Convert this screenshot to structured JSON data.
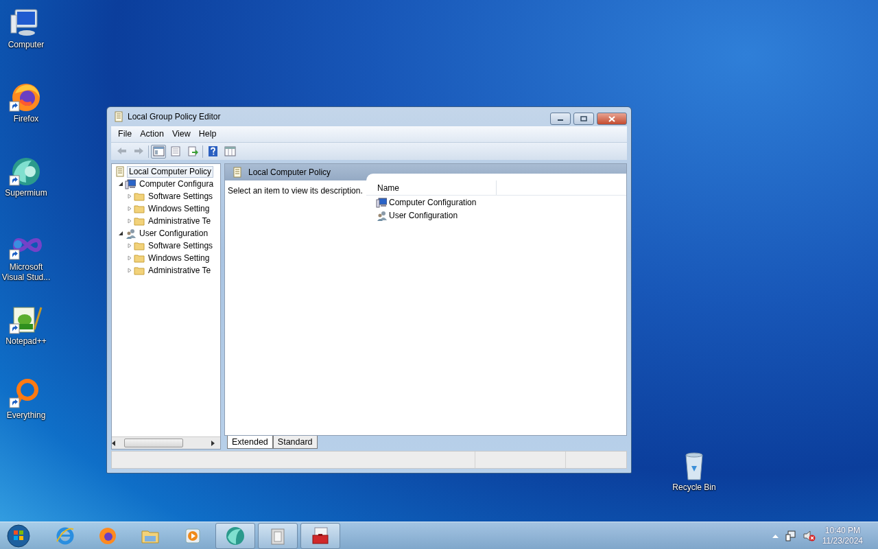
{
  "desktop_icons": [
    {
      "label": "Computer",
      "kind": "computer",
      "shortcut": false
    },
    {
      "label": "Firefox",
      "kind": "firefox",
      "shortcut": true
    },
    {
      "label": "Supermium",
      "kind": "supermium",
      "shortcut": true
    },
    {
      "label": "Microsoft Visual Stud...",
      "kind": "vs",
      "shortcut": true
    },
    {
      "label": "Notepad++",
      "kind": "notepad",
      "shortcut": true
    },
    {
      "label": "Everything",
      "kind": "everything",
      "shortcut": true
    }
  ],
  "recycle_bin": {
    "label": "Recycle Bin"
  },
  "window": {
    "title": "Local Group Policy Editor",
    "menu": [
      "File",
      "Action",
      "View",
      "Help"
    ],
    "toolbar": [
      {
        "kind": "back",
        "disabled": true,
        "pressed": false
      },
      {
        "kind": "forward",
        "disabled": true,
        "pressed": false
      },
      {
        "kind": "tree",
        "disabled": false,
        "pressed": true
      },
      {
        "kind": "properties",
        "disabled": false,
        "pressed": false
      },
      {
        "kind": "export",
        "disabled": false,
        "pressed": false
      },
      {
        "kind": "help",
        "disabled": false,
        "pressed": false
      },
      {
        "kind": "view",
        "disabled": false,
        "pressed": false
      }
    ],
    "tree": {
      "label": "Local Computer Policy",
      "kind": "policy",
      "selected": true,
      "children": [
        {
          "label": "Computer Configura",
          "kind": "computer",
          "expanded": true,
          "selected": false,
          "children": [
            {
              "label": "Software Settings",
              "kind": "folder",
              "expanded": false,
              "selected": false
            },
            {
              "label": "Windows Setting",
              "kind": "folder",
              "expanded": false,
              "selected": false
            },
            {
              "label": "Administrative Te",
              "kind": "folder",
              "expanded": false,
              "selected": false
            }
          ]
        },
        {
          "label": "User Configuration",
          "kind": "user",
          "expanded": true,
          "selected": false,
          "children": [
            {
              "label": "Software Settings",
              "kind": "folder",
              "expanded": false,
              "selected": false
            },
            {
              "label": "Windows Setting",
              "kind": "folder",
              "expanded": false,
              "selected": false
            },
            {
              "label": "Administrative Te",
              "kind": "folder",
              "expanded": false,
              "selected": false
            }
          ]
        }
      ]
    },
    "detail": {
      "header": "Local Computer Policy",
      "description": "Select an item to view its description.",
      "columns": [
        "Name"
      ],
      "items": [
        {
          "label": "Computer Configuration",
          "kind": "computer"
        },
        {
          "label": "User Configuration",
          "kind": "user"
        }
      ]
    },
    "tabs": [
      {
        "label": "Extended",
        "selected": true
      },
      {
        "label": "Standard",
        "selected": false
      }
    ]
  },
  "taskbar": {
    "items": [
      {
        "kind": "ie",
        "running": false
      },
      {
        "kind": "firefox",
        "running": false
      },
      {
        "kind": "explorer",
        "running": false
      },
      {
        "kind": "media",
        "running": false
      },
      {
        "kind": "supermium",
        "running": true
      },
      {
        "kind": "files",
        "running": true
      },
      {
        "kind": "toolbox",
        "running": true
      }
    ],
    "time": "10:40 PM",
    "date": "11/23/2024"
  }
}
